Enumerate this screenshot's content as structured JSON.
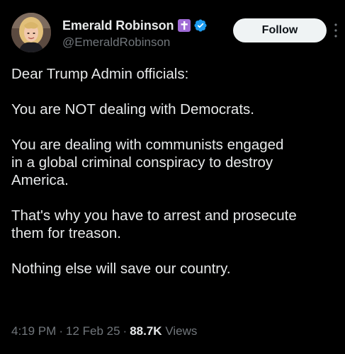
{
  "author": {
    "display_name": "Emerald Robinson",
    "handle": "@EmeraldRobinson",
    "badges": [
      "cross-badge",
      "verified-badge"
    ],
    "verified_color": "#1d9bf0",
    "cross_badge_color": "#a06bd6"
  },
  "actions": {
    "follow_label": "Follow",
    "more_icon": "more-vertical-icon"
  },
  "tweet": {
    "paragraphs": [
      "Dear Trump Admin officials:",
      "You are NOT dealing with Democrats.",
      "You are dealing with communists engaged\nin a global criminal conspiracy to destroy\nAmerica.",
      "That's why you have to arrest and prosecute\nthem for treason.",
      "Nothing else will save our country."
    ]
  },
  "meta": {
    "time": "4:19 PM",
    "date": "12 Feb 25",
    "views_count": "88.7K",
    "views_label": "Views",
    "separator": "·"
  },
  "colors": {
    "background": "#000000",
    "text": "#e7e9ea",
    "secondary_text": "#71767b",
    "follow_button_bg": "#eff3f4"
  }
}
